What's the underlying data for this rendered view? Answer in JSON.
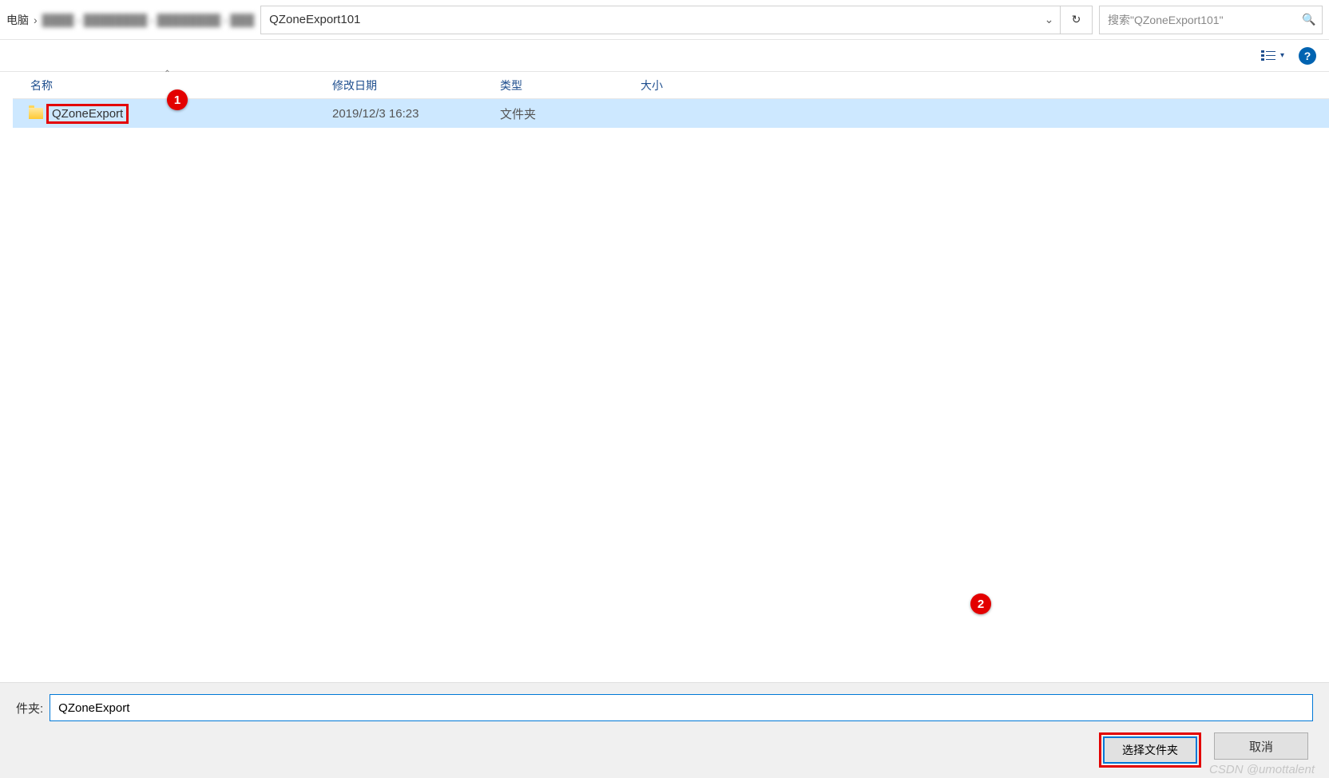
{
  "breadcrumb": {
    "root": "电脑"
  },
  "address": {
    "current": "QZoneExport101"
  },
  "search": {
    "placeholder": "搜索\"QZoneExport101\""
  },
  "columns": {
    "name": "名称",
    "date": "修改日期",
    "type": "类型",
    "size": "大小"
  },
  "rows": [
    {
      "name": "QZoneExport",
      "date": "2019/12/3 16:23",
      "type": "文件夹",
      "size": ""
    }
  ],
  "footer": {
    "folder_label": "件夹:",
    "folder_value": "QZoneExport",
    "select_btn": "选择文件夹",
    "cancel_btn": "取消"
  },
  "annotations": {
    "badge1": "1",
    "badge2": "2"
  },
  "watermark": "CSDN @umottalent"
}
